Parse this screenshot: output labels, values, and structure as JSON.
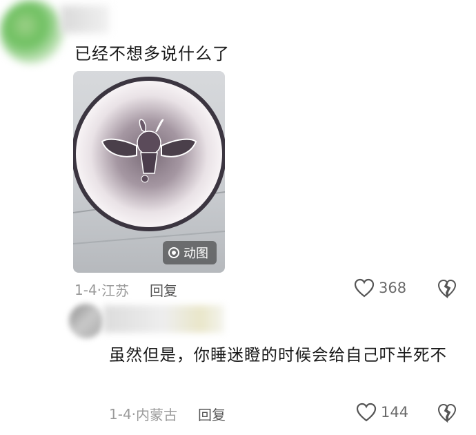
{
  "comments": [
    {
      "text": "已经不想多说什么了",
      "media_badge": "动图",
      "date": "1-4",
      "location": "江苏",
      "reply_label": "回复",
      "likes": "368"
    },
    {
      "text": "虽然但是，你睡迷瞪的时候会给自己吓半死不",
      "date": "1-4",
      "location": "内蒙古",
      "reply_label": "回复",
      "likes": "144"
    }
  ],
  "icons": {
    "like": "heart-outline-icon",
    "dislike": "broken-heart-icon",
    "media": "animated-image-icon"
  },
  "colors": {
    "text": "#1a1a1a",
    "meta": "#9a9a9a",
    "icon": "#555555"
  }
}
